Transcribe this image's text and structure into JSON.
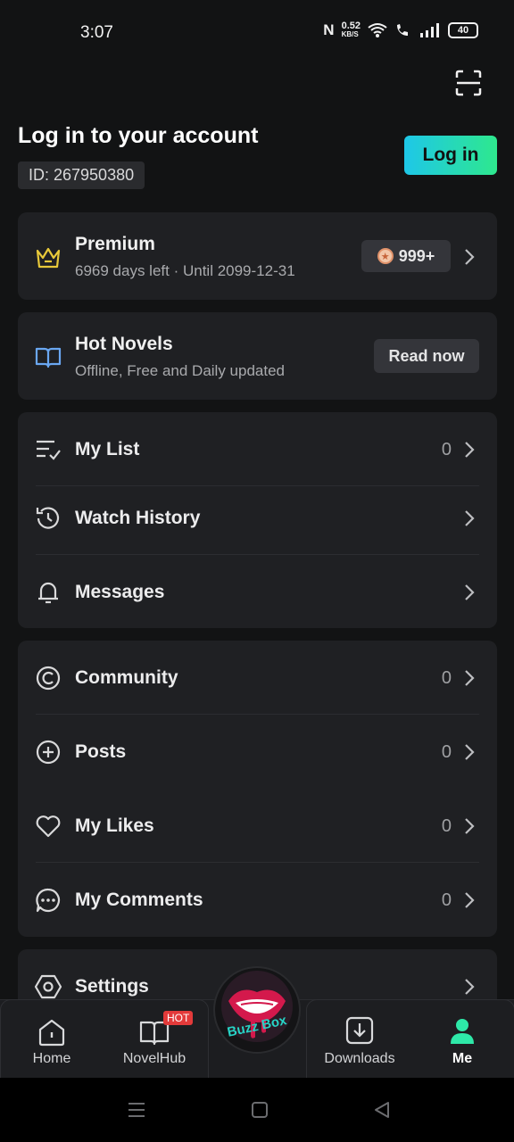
{
  "status_bar": {
    "time": "3:07",
    "net_speed_value": "0.52",
    "net_speed_unit": "KB/S",
    "battery": "40"
  },
  "header": {
    "title": "Log in to your account",
    "user_id": "ID: 267950380",
    "login_label": "Log in"
  },
  "premium": {
    "title": "Premium",
    "subtitle": "6969 days left · Until 2099-12-31",
    "coins": "999+"
  },
  "hot_novels": {
    "title": "Hot Novels",
    "subtitle": "Offline, Free and Daily updated",
    "button": "Read now"
  },
  "group1": [
    {
      "label": "My List",
      "count": "0",
      "icon": "list-icon"
    },
    {
      "label": "Watch History",
      "count": "",
      "icon": "history-icon"
    },
    {
      "label": "Messages",
      "count": "",
      "icon": "bell-icon"
    }
  ],
  "group2": [
    {
      "label": "Community",
      "count": "0",
      "icon": "community-icon"
    },
    {
      "label": "Posts",
      "count": "0",
      "icon": "plus-circle-icon"
    },
    {
      "label": "My Likes",
      "count": "0",
      "icon": "heart-icon"
    },
    {
      "label": "My Comments",
      "count": "0",
      "icon": "comment-icon"
    }
  ],
  "group3": [
    {
      "label": "Settings",
      "icon": "settings-icon"
    }
  ],
  "bottom_nav": {
    "items": [
      {
        "label": "Home",
        "icon": "home-icon"
      },
      {
        "label": "NovelHub",
        "icon": "book-icon",
        "badge": "HOT"
      },
      {
        "label": "Downloads",
        "icon": "download-icon"
      },
      {
        "label": "Me",
        "icon": "person-icon",
        "active": true
      }
    ],
    "center_logo": "Buzz Box"
  },
  "colors": {
    "accent_gradient_start": "#1ec7e8",
    "accent_gradient_end": "#2ee88e",
    "active_nav": "#2ee8a8",
    "background": "#121314",
    "card": "#1f2023"
  }
}
